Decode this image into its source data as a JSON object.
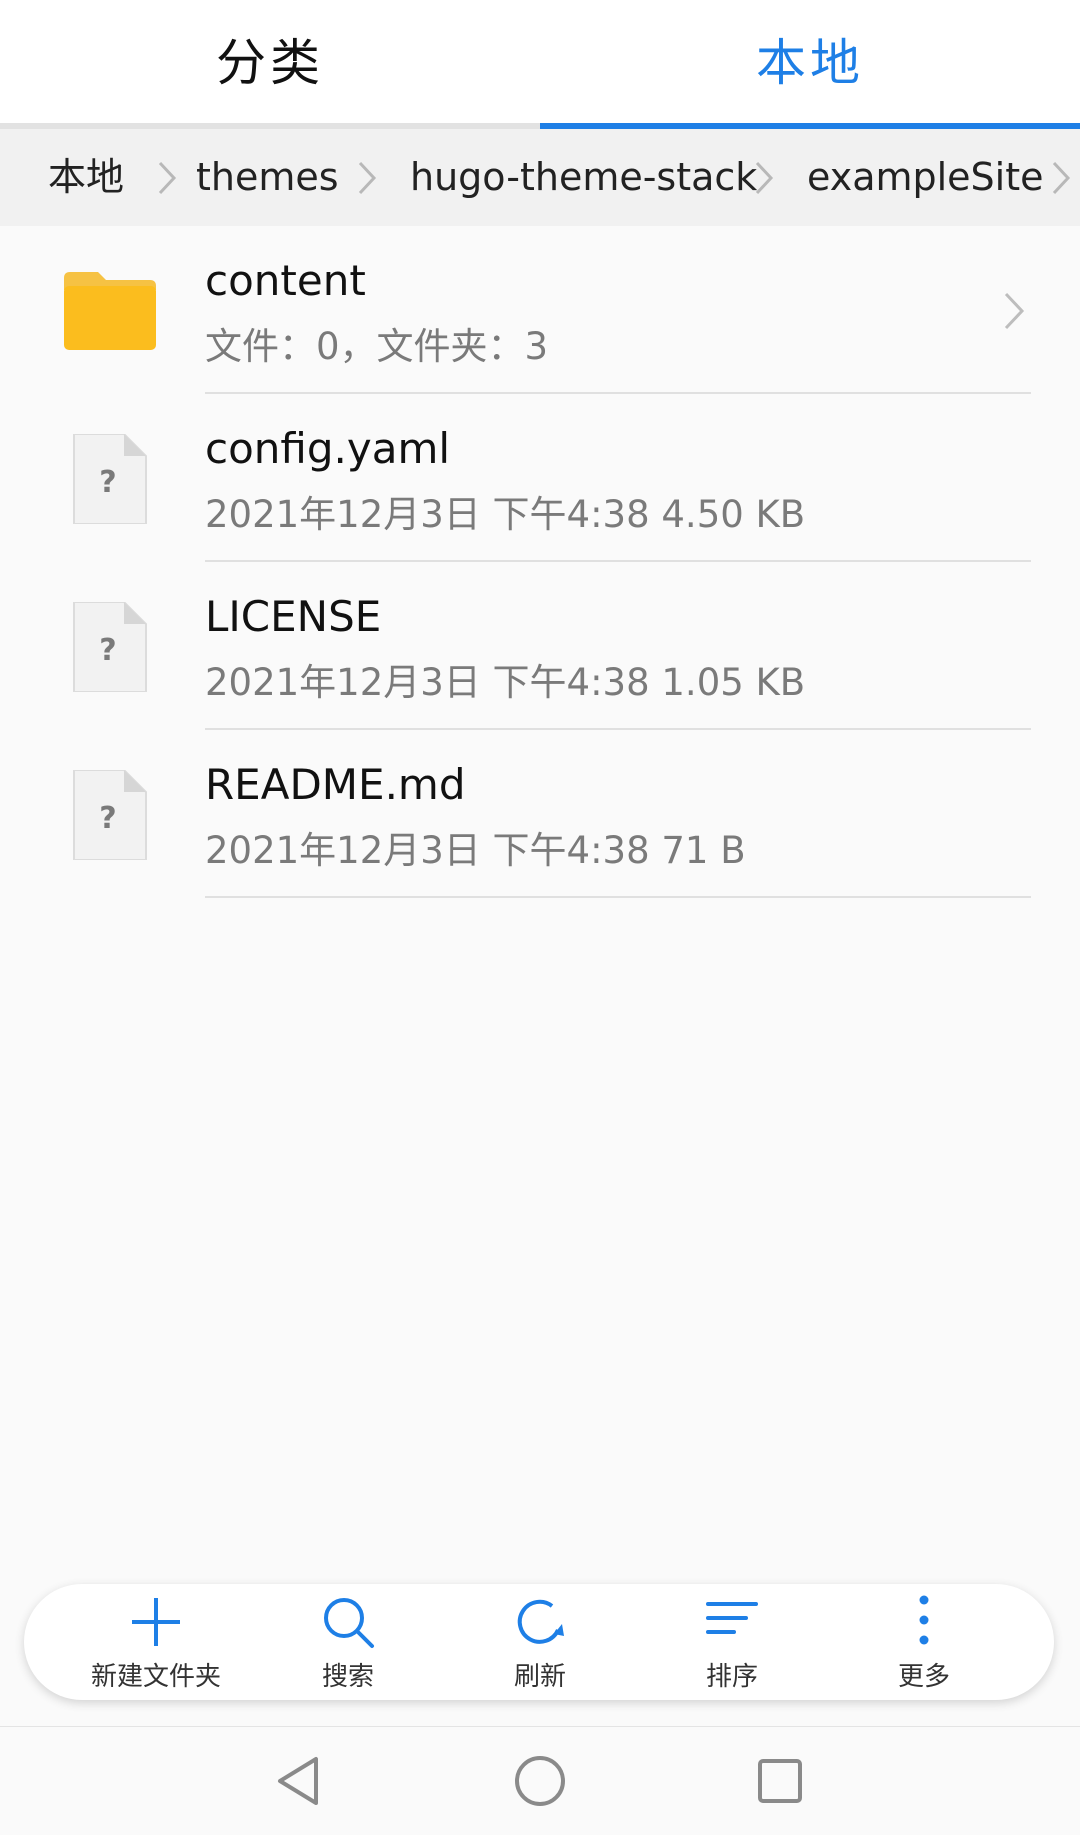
{
  "tabs": [
    {
      "label": "分类",
      "active": false
    },
    {
      "label": "本地",
      "active": true
    }
  ],
  "accent_color": "#1e7fe6",
  "breadcrumb": [
    "本地",
    "themes",
    "hugo-theme-stack",
    "exampleSite"
  ],
  "files": [
    {
      "name": "content",
      "meta": "文件：0，文件夹：3",
      "type": "folder-icon"
    },
    {
      "name": "config.yaml",
      "meta": "2021年12月3日 下午4:38 4.50 KB",
      "type": "unknown-file-icon"
    },
    {
      "name": "LICENSE",
      "meta": "2021年12月3日 下午4:38 1.05 KB",
      "type": "unknown-file-icon"
    },
    {
      "name": "README.md",
      "meta": "2021年12月3日 下午4:38 71 B",
      "type": "unknown-file-icon"
    }
  ],
  "actions": [
    {
      "label": "新建文件夹",
      "icon": "plus-icon"
    },
    {
      "label": "搜索",
      "icon": "search-icon"
    },
    {
      "label": "刷新",
      "icon": "refresh-icon"
    },
    {
      "label": "排序",
      "icon": "sort-icon"
    },
    {
      "label": "更多",
      "icon": "more-vertical-icon"
    }
  ],
  "system_nav": [
    "back-icon",
    "home-icon",
    "recents-icon"
  ]
}
